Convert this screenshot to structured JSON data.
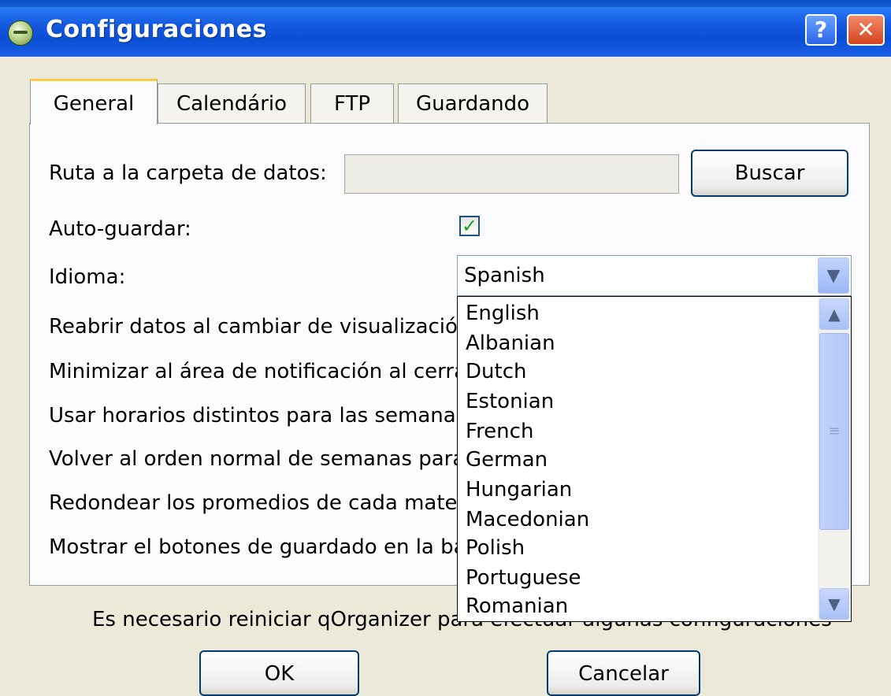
{
  "window": {
    "title": "Configuraciones",
    "help_label": "?",
    "close_label": "✕"
  },
  "tabs": [
    {
      "label": "General",
      "active": true
    },
    {
      "label": "Calendário",
      "active": false
    },
    {
      "label": "FTP",
      "active": false
    },
    {
      "label": "Guardando",
      "active": false
    }
  ],
  "general": {
    "data_folder_label": "Ruta a la carpeta de datos:",
    "data_folder_value": "",
    "browse_label": "Buscar",
    "autosave_label": "Auto-guardar:",
    "autosave_checked": true,
    "language_label": "Idioma:",
    "language_selected": "Spanish",
    "options": [
      "Reabrir datos al cambiar de visualización",
      "Minimizar al área de notificación al cerrar",
      "Usar horarios distintos para las semanas",
      "Volver al orden normal de semanas para",
      "Redondear los promedios de cada mater",
      "Mostrar el botones de guardado en la ba"
    ]
  },
  "language_dropdown": {
    "items": [
      "English",
      "Albanian",
      "Dutch",
      "Estonian",
      "French",
      "German",
      "Hungarian",
      "Macedonian",
      "Polish",
      "Portuguese",
      "Romanian"
    ]
  },
  "notice": "Es necesario reiniciar qOrganizer para efectuar algunas configuraciones",
  "buttons": {
    "ok_label": "OK",
    "cancel_label": "Cancelar"
  },
  "colors": {
    "titlebar": "#0b4fd6",
    "dialog_bg": "#ece9d8",
    "panel_bg": "#fcfcfe",
    "active_tab_accent": "#ffc83c"
  },
  "icons": {
    "app": "app-globe-icon",
    "help": "help-icon",
    "close": "close-icon",
    "check": "checkmark-icon",
    "dropdown": "chevron-down-icon"
  }
}
